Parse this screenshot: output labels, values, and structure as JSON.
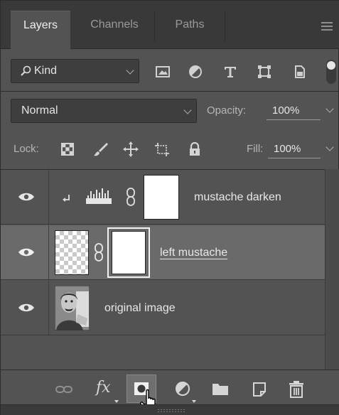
{
  "tabs": [
    {
      "label": "Layers",
      "active": true
    },
    {
      "label": "Channels",
      "active": false
    },
    {
      "label": "Paths",
      "active": false
    }
  ],
  "filter": {
    "kind_label": "Kind",
    "filter_icons": [
      "image-filter-icon",
      "adjustment-filter-icon",
      "type-filter-icon",
      "shape-filter-icon",
      "smart-object-filter-icon"
    ]
  },
  "blend": {
    "mode": "Normal",
    "opacity_label": "Opacity:",
    "opacity_value": "100%"
  },
  "lock": {
    "label": "Lock:",
    "fill_label": "Fill:",
    "fill_value": "100%",
    "icons": [
      "lock-transparent-pixels-icon",
      "lock-image-pixels-icon",
      "lock-position-icon",
      "prevent-autonest-icon",
      "lock-all-icon"
    ]
  },
  "layers": [
    {
      "name": "mustache darken",
      "type": "adjustment",
      "clipped": true,
      "visible": true,
      "selected": false
    },
    {
      "name": "left mustache",
      "type": "pixel-with-mask",
      "visible": true,
      "selected": true
    },
    {
      "name": "original image",
      "type": "pixel",
      "visible": true,
      "selected": false
    }
  ],
  "bottom_icons": [
    "link-layers-icon",
    "fx-icon",
    "add-mask-icon",
    "new-adjustment-layer-icon",
    "new-group-icon",
    "new-layer-icon",
    "delete-icon"
  ],
  "fx_label": "fx",
  "colors": {
    "panel": "#535353",
    "tabbar": "#393939",
    "selected_row": "#6a6a6a"
  }
}
